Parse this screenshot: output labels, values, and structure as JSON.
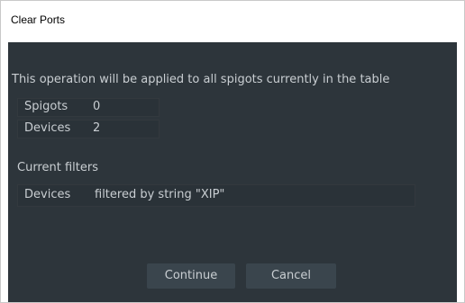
{
  "dialog": {
    "title": "Clear Ports",
    "message": "This operation will be applied to all spigots currently in the table",
    "counts": [
      {
        "label": "Spigots",
        "value": "0"
      },
      {
        "label": "Devices",
        "value": "2"
      }
    ],
    "filters_heading": "Current filters",
    "filters": [
      {
        "label": "Devices",
        "value": "filtered by string \"XIP\""
      }
    ],
    "continue_label": "Continue",
    "cancel_label": "Cancel"
  },
  "colors": {
    "background": "#2d353b",
    "text": "#c9ced2",
    "button": "#3a454d"
  }
}
